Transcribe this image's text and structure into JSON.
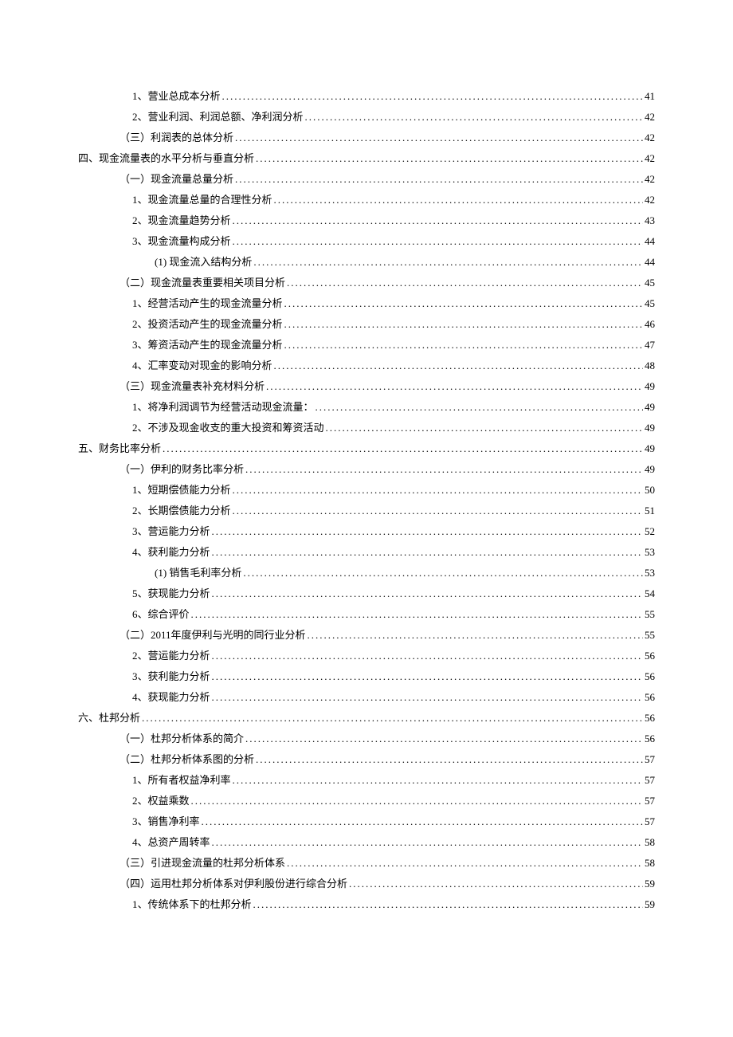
{
  "toc": [
    {
      "level": 3,
      "label": "1、营业总成本分析",
      "page": "41"
    },
    {
      "level": 3,
      "label": "2、营业利润、利润总额、净利润分析",
      "page": "42"
    },
    {
      "level": 2,
      "label": "（三）利润表的总体分析",
      "page": "42"
    },
    {
      "level": 1,
      "label": "四、现金流量表的水平分析与垂直分析",
      "page": "42"
    },
    {
      "level": 2,
      "label": "（一）现金流量总量分析",
      "page": "42"
    },
    {
      "level": 3,
      "label": "1、现金流量总量的合理性分析",
      "page": "42"
    },
    {
      "level": 3,
      "label": "2、现金流量趋势分析",
      "page": "43"
    },
    {
      "level": 3,
      "label": "3、现金流量构成分析",
      "page": "44"
    },
    {
      "level": 4,
      "label": "(1) 现金流入结构分析",
      "page": "44"
    },
    {
      "level": 2,
      "label": "（二）现金流量表重要相关项目分析",
      "page": "45"
    },
    {
      "level": 3,
      "label": "1、经营活动产生的现金流量分析",
      "page": "45"
    },
    {
      "level": 3,
      "label": "2、投资活动产生的现金流量分析",
      "page": "46"
    },
    {
      "level": 3,
      "label": "3、筹资活动产生的现金流量分析",
      "page": "47"
    },
    {
      "level": 3,
      "label": "4、汇率变动对现金的影响分析",
      "page": "48"
    },
    {
      "level": 2,
      "label": "（三）现金流量表补充材料分析",
      "page": "49"
    },
    {
      "level": 3,
      "label": "1、将净利润调节为经营活动现金流量：",
      "page": "49"
    },
    {
      "level": 3,
      "label": "2、不涉及现金收支的重大投资和筹资活动",
      "page": "49"
    },
    {
      "level": 1,
      "label": "五、财务比率分析",
      "page": "49"
    },
    {
      "level": 2,
      "label": "（一）伊利的财务比率分析",
      "page": "49"
    },
    {
      "level": 3,
      "label": "1、短期偿债能力分析",
      "page": "50"
    },
    {
      "level": 3,
      "label": "2、长期偿债能力分析",
      "page": "51"
    },
    {
      "level": 3,
      "label": "3、营运能力分析",
      "page": "52"
    },
    {
      "level": 3,
      "label": "4、获利能力分析",
      "page": "53"
    },
    {
      "level": 4,
      "label": "(1) 销售毛利率分析",
      "page": "53"
    },
    {
      "level": 3,
      "label": "5、获现能力分析",
      "page": "54"
    },
    {
      "level": 3,
      "label": "6、综合评价",
      "page": "55"
    },
    {
      "level": 2,
      "label": "（二）2011年度伊利与光明的同行业分析",
      "page": "55"
    },
    {
      "level": 3,
      "label": "2、营运能力分析",
      "page": "56"
    },
    {
      "level": 3,
      "label": "3、获利能力分析",
      "page": "56"
    },
    {
      "level": 3,
      "label": "4、获现能力分析",
      "page": "56"
    },
    {
      "level": 1,
      "label": "六、杜邦分析",
      "page": "56"
    },
    {
      "level": 2,
      "label": "（一）杜邦分析体系的简介",
      "page": "56"
    },
    {
      "level": 2,
      "label": "（二）杜邦分析体系图的分析",
      "page": "57"
    },
    {
      "level": 3,
      "label": "1、所有者权益净利率",
      "page": "57"
    },
    {
      "level": 3,
      "label": "2、权益乘数",
      "page": "57"
    },
    {
      "level": 3,
      "label": "3、销售净利率",
      "page": "57"
    },
    {
      "level": 3,
      "label": "4、总资产周转率",
      "page": "58"
    },
    {
      "level": 2,
      "label": "（三）引进现金流量的杜邦分析体系",
      "page": "58"
    },
    {
      "level": 2,
      "label": "（四）运用杜邦分析体系对伊利股份进行综合分析",
      "page": "59"
    },
    {
      "level": 3,
      "label": "1、传统体系下的杜邦分析",
      "page": "59"
    }
  ]
}
